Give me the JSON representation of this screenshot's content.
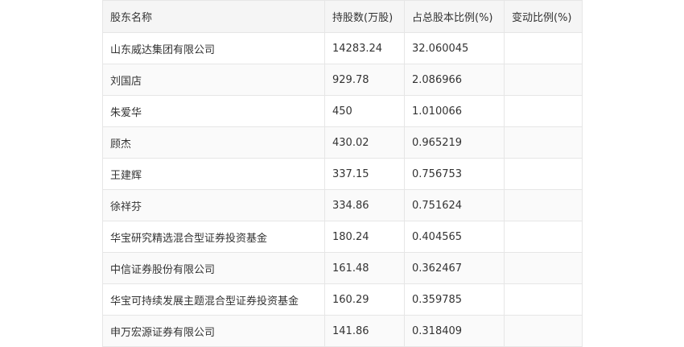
{
  "table": {
    "headers": [
      "股东名称",
      "持股数(万股)",
      "占总股本比例(%)",
      "变动比例(%)"
    ],
    "rows": [
      {
        "name": "山东威达集团有限公司",
        "shares": "14283.24",
        "ratio": "32.060045",
        "change": ""
      },
      {
        "name": "刘国店",
        "shares": "929.78",
        "ratio": "2.086966",
        "change": ""
      },
      {
        "name": "朱爱华",
        "shares": "450",
        "ratio": "1.010066",
        "change": ""
      },
      {
        "name": "顾杰",
        "shares": "430.02",
        "ratio": "0.965219",
        "change": ""
      },
      {
        "name": "王建辉",
        "shares": "337.15",
        "ratio": "0.756753",
        "change": ""
      },
      {
        "name": "徐祥芬",
        "shares": "334.86",
        "ratio": "0.751624",
        "change": ""
      },
      {
        "name": "华宝研究精选混合型证券投资基金",
        "shares": "180.24",
        "ratio": "0.404565",
        "change": ""
      },
      {
        "name": "中信证券股份有限公司",
        "shares": "161.48",
        "ratio": "0.362467",
        "change": ""
      },
      {
        "name": "华宝可持续发展主题混合型证券投资基金",
        "shares": "160.29",
        "ratio": "0.359785",
        "change": ""
      },
      {
        "name": "申万宏源证券有限公司",
        "shares": "141.86",
        "ratio": "0.318409",
        "change": ""
      }
    ]
  }
}
